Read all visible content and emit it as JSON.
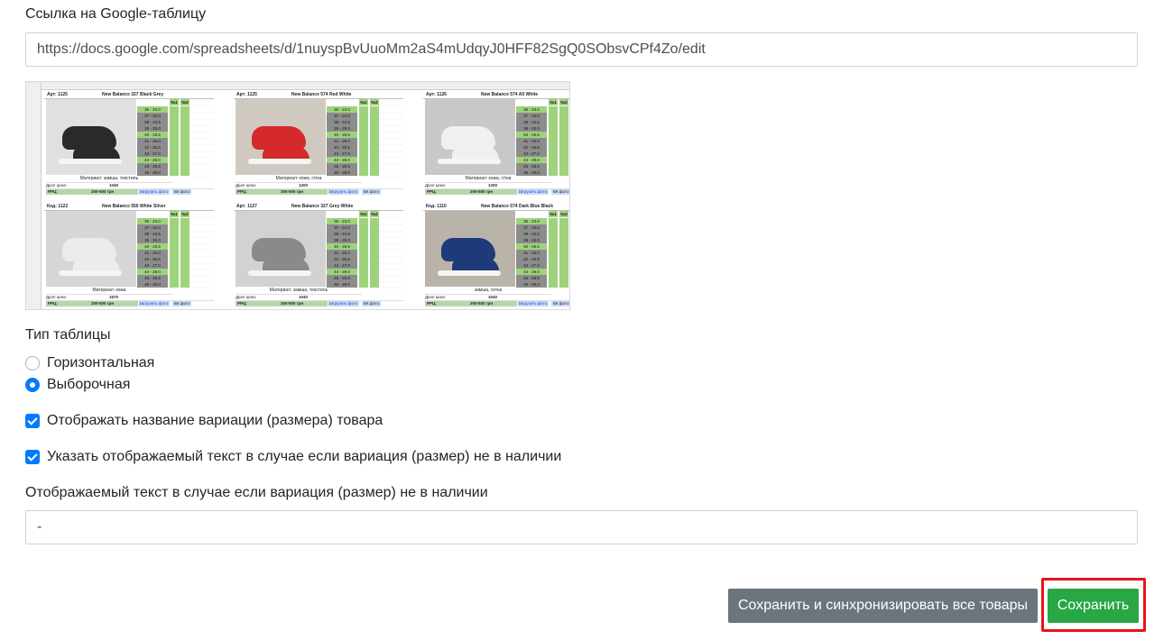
{
  "sheet_link_label": "Ссылка на Google-таблицу",
  "sheet_link_value": "https://docs.google.com/spreadsheets/d/1nuyspBvUuoMm2aS4mUdqyJ0HFF82SgQ0SObsvCPf4Zo/edit",
  "table_type_label": "Тип таблицы",
  "table_type_options": [
    "Горизонтальная",
    "Выборочная"
  ],
  "table_type_selected": "Выборочная",
  "show_variation_name_label": "Отображать название вариации (размера) товара",
  "show_variation_name_checked": true,
  "specify_text_label": "Указать отображаемый текст в случае если вариация (размер) не в наличии",
  "specify_text_checked": true,
  "unavailable_text_label": "Отображаемый текст в случае если вариация (размер) не в наличии",
  "unavailable_text_value": "-",
  "buttons": {
    "save_sync_label": "Сохранить и синхронизировать все товары",
    "save_label": "Сохранить"
  },
  "colors": {
    "primary": "#007bff",
    "secondary_button": "#6c757d",
    "success_button": "#28a745",
    "highlight_border": "#e8141b"
  },
  "preview": {
    "size_header": [
      "№1",
      "№2"
    ],
    "cards": [
      {
        "art": "Арт: 1125",
        "name": "New Balance 327 Black Grey",
        "material": "Материал: замша, текстиль",
        "price_drop": "Дроп цена:",
        "price_drop_value": "1040",
        "rrc": "РРЦ:",
        "rrc_value": "200-500 грн",
        "link": "Загрузить фото",
        "bk": "БК фото",
        "shoe": "#2a2a2a",
        "bg": "#e0e0e0"
      },
      {
        "art": "Арт: 1125",
        "name": "New Balance 574 Red White",
        "material": "Материал: кожа, сітка",
        "price_drop": "Дроп цена:",
        "price_drop_value": "1200",
        "rrc": "РРЦ:",
        "rrc_value": "200-500 грн",
        "link": "Загрузить фото",
        "bk": "БК фото",
        "shoe": "#d42a2a",
        "bg": "#cfc9c2"
      },
      {
        "art": "Арт: 1126",
        "name": "New Balance 574 All White",
        "material": "Материал: кожа, сітка",
        "price_drop": "Дроп цена:",
        "price_drop_value": "1200",
        "rrc": "РРЦ:",
        "rrc_value": "200-500 грн",
        "link": "Загрузить фото",
        "bk": "БК фото",
        "shoe": "#f0f0f0",
        "bg": "#c8c8c8"
      },
      {
        "art": "Код: 1122",
        "name": "New Balance 550 White Silver",
        "material": "Материал: кожа",
        "price_drop": "Дроп цена:",
        "price_drop_value": "1570",
        "rrc": "РРЦ:",
        "rrc_value": "200-500 грн",
        "link": "Загрузить фото",
        "bk": "БК фото",
        "shoe": "#ececec",
        "bg": "#d6d6d6"
      },
      {
        "art": "Арт: 1127",
        "name": "New Balance 327 Grey White",
        "material": "Материал: замша, текстиль",
        "price_drop": "Дроп цена:",
        "price_drop_value": "1040",
        "rrc": "РРЦ:",
        "rrc_value": "200-500 грн",
        "link": "Загрузить фото",
        "bk": "БК фото",
        "shoe": "#8a8a8a",
        "bg": "#d2d2d2"
      },
      {
        "art": "Код: 1110",
        "name": "New Balance 574 Dark Blue Black",
        "material": "замша, сетка",
        "price_drop": "Дроп цена:",
        "price_drop_value": "1040",
        "rrc": "РРЦ:",
        "rrc_value": "200-500 грн",
        "link": "Загрузить фото",
        "bk": "БК фото",
        "shoe": "#1f3a78",
        "bg": "#b9b3aa"
      }
    ],
    "sizes": [
      "36 - 23.0",
      "37 - 24.0",
      "38 - 24.5",
      "39 - 25.0",
      "40 - 25.5",
      "41 - 26.0",
      "42 - 26.5",
      "43 - 27.0",
      "44 - 28.0",
      "45 - 28.5",
      "46 - 29.0"
    ]
  }
}
